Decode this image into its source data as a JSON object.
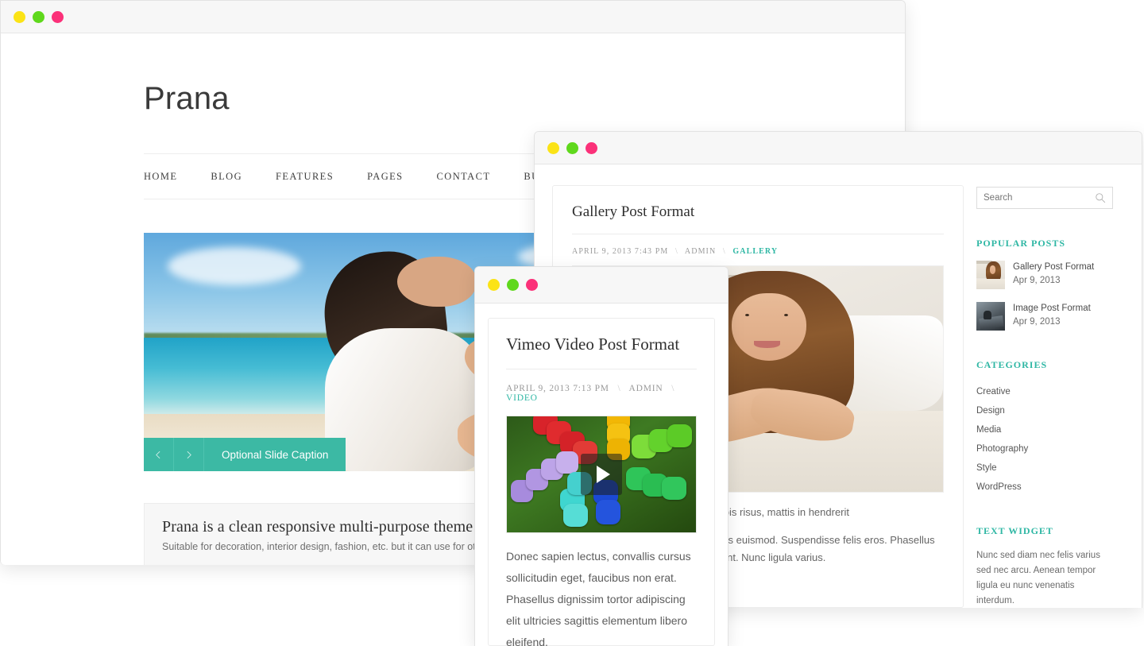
{
  "accent": "#2fb7a4",
  "window_dots": [
    "yellow",
    "green",
    "pink"
  ],
  "site_window": {
    "brand": "Prana",
    "nav": [
      {
        "label": "HOME"
      },
      {
        "label": "BLOG"
      },
      {
        "label": "FEATURES"
      },
      {
        "label": "PAGES"
      },
      {
        "label": "CONTACT"
      },
      {
        "label": "BUY NOW"
      }
    ],
    "slider": {
      "prev_icon": "chevron-left-icon",
      "next_icon": "chevron-right-icon",
      "caption": "Optional Slide Caption",
      "image_alt": "Woman reading a book on a tropical beach"
    },
    "promo": {
      "heading": "Prana is a clean responsive multi-purpose theme",
      "subtext": "Suitable for decoration, interior design, fashion, etc. but it can use for other purposes."
    }
  },
  "gallery_window": {
    "post": {
      "title": "Gallery Post Format",
      "meta_date": "APRIL 9, 2013 7:43 PM",
      "meta_sep": "\\",
      "meta_author": "ADMIN",
      "meta_category": "GALLERY",
      "image_alt": "Smiling young woman leaning on a white sofa",
      "paragraphs": [
        "od. Suspendisse potenti. Duis turpis risus, mattis in hendrerit",
        "lum elit auctor. Duis sagittis lobortis euismod. Suspendisse felis eros. Phasellus eu leo dictum nunc ultrices tincidunt. Nunc ligula varius."
      ]
    },
    "sidebar": {
      "search": {
        "placeholder": "Search",
        "value": "",
        "icon": "search-icon"
      },
      "popular_posts": {
        "title": "POPULAR POSTS",
        "items": [
          {
            "title": "Gallery Post Format",
            "date": "Apr 9, 2013"
          },
          {
            "title": "Image Post Format",
            "date": "Apr 9, 2013"
          }
        ]
      },
      "categories": {
        "title": "CATEGORIES",
        "items": [
          "Creative",
          "Design",
          "Media",
          "Photography",
          "Style",
          "WordPress"
        ]
      },
      "text_widget": {
        "title": "TEXT WIDGET",
        "body": "Nunc sed diam nec felis varius sed nec arcu. Aenean tempor ligula eu nunc venenatis interdum."
      }
    }
  },
  "video_window": {
    "post": {
      "title": "Vimeo Video Post Format",
      "meta_date": "APRIL 9, 2013 7:13 PM",
      "meta_sep": "\\",
      "meta_author": "ADMIN",
      "meta_category": "VIDEO",
      "video_alt": "Aerial view of colorful umbrellas arranged on grass",
      "play_icon": "play-icon",
      "body": "Donec sapien lectus, convallis cursus sollicitudin eget, faucibus non erat. Phasellus dignissim tortor adipiscing elit ultricies sagittis elementum libero eleifend."
    }
  }
}
